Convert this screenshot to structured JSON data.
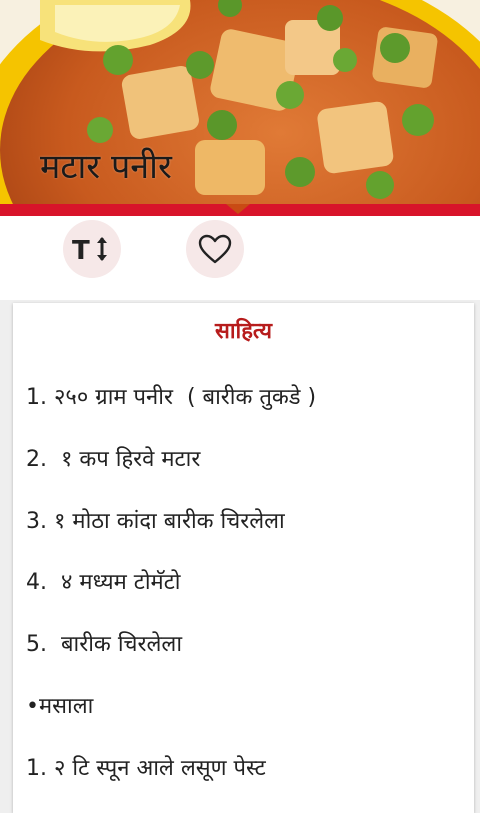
{
  "header": {
    "title": "मटार पनीर",
    "accent_color": "#d8142a"
  },
  "toolbar": {
    "text_size_icon": "text-size-icon",
    "favorite_icon": "heart-outline-icon"
  },
  "ingredients": {
    "heading": "साहित्य",
    "lines": [
      "1. २५० ग्राम पनीर  ( बारीक तुकडे )",
      "2.  १ कप हिरवे मटार",
      "3. १ मोठा कांदा बारीक चिरलेला",
      "4.  ४ मध्यम टोमॅटो",
      "5.  बारीक चिरलेला",
      "•मसाला",
      "1. २ टि स्पून आले लसूण पेस्ट"
    ]
  }
}
